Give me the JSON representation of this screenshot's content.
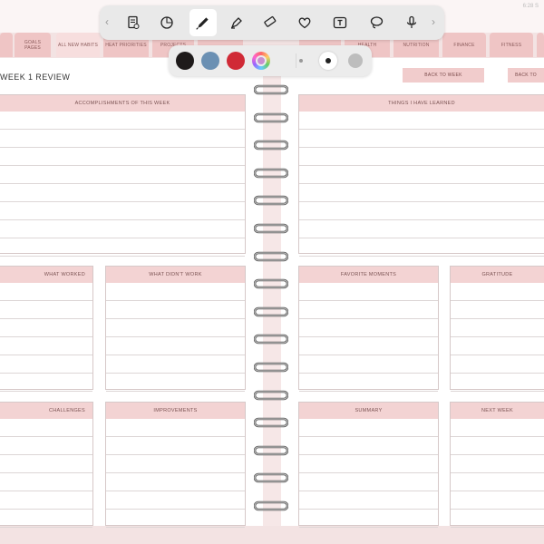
{
  "status": {
    "time": "6:28 S"
  },
  "tabs": [
    {
      "label": ""
    },
    {
      "label": "GOALS PAGES"
    },
    {
      "label": "ALL NEW HABITS"
    },
    {
      "label": "HEAT PRIORITIES"
    },
    {
      "label": "PROJECTS"
    },
    {
      "label": ""
    },
    {
      "label": ""
    },
    {
      "label": "HEALTH"
    },
    {
      "label": "NUTRITION"
    },
    {
      "label": "FINANCE"
    },
    {
      "label": "FITNESS"
    },
    {
      "label": ""
    }
  ],
  "header": {
    "title": "WEEK 1 REVIEW",
    "back_left": "BACK TO WEEK",
    "back_right": "BACK TO"
  },
  "boxes": {
    "accomplishments": "ACCOMPLISHMENTS OF THIS WEEK",
    "things_learned": "THINGS I HAVE LEARNED",
    "what_worked": "WHAT WORKED",
    "what_didnt": "WHAT DIDN'T WORK",
    "favorite_moments": "FAVORITE MOMENTS",
    "gratitude": "GRATITUDE",
    "challenges": "CHALLENGES",
    "improvements": "IMPROVEMENTS",
    "summary": "SUMMARY",
    "next_week": "NEXT WEEK"
  },
  "toolbar": {
    "items": [
      "document-icon",
      "shapes-icon",
      "pen-icon",
      "highlighter-icon",
      "eraser-icon",
      "sticker-icon",
      "textbox-icon",
      "lasso-icon",
      "microphone-icon"
    ],
    "active": "pen-icon",
    "chev_left": "‹",
    "chev_right": "›"
  },
  "colors": {
    "black": "#1e1a1a",
    "blue": "#6b90b3",
    "red": "#d02a36",
    "pink": "#efc5c5",
    "header": "#f3d3d3"
  }
}
